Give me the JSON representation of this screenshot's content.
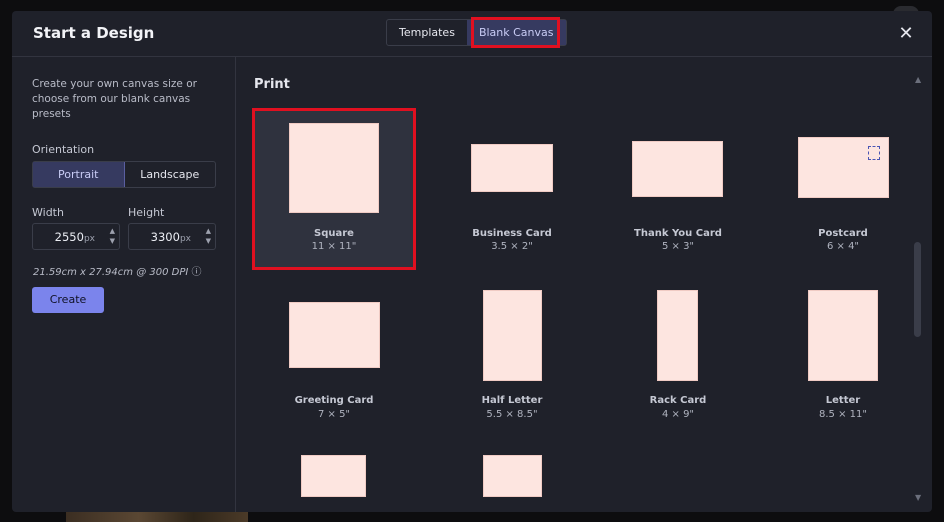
{
  "modal": {
    "title": "Start a Design",
    "tabs": [
      {
        "label": "Templates",
        "active": false
      },
      {
        "label": "Blank Canvas",
        "active": true
      }
    ],
    "close_icon": "close-icon"
  },
  "left_panel": {
    "description": "Create your own canvas size or choose from our blank canvas presets",
    "orientation_label": "Orientation",
    "orientation_options": [
      "Portrait",
      "Landscape"
    ],
    "orientation_selected": "Portrait",
    "width_label": "Width",
    "width_value": "2550",
    "height_label": "Height",
    "height_value": "3300",
    "unit": "px",
    "dimension_info": "21.59cm x 27.94cm @ 300 DPI",
    "info_icon": "info-icon",
    "create_label": "Create"
  },
  "print_section": {
    "heading": "Print",
    "presets": [
      {
        "name": "Square",
        "size": "11 × 11\"",
        "selected": true
      },
      {
        "name": "Business Card",
        "size": "3.5 × 2\""
      },
      {
        "name": "Thank You Card",
        "size": "5 × 3\""
      },
      {
        "name": "Postcard",
        "size": "6 × 4\""
      },
      {
        "name": "Greeting Card",
        "size": "7 × 5\""
      },
      {
        "name": "Half Letter",
        "size": "5.5 × 8.5\""
      },
      {
        "name": "Rack Card",
        "size": "4 × 9\""
      },
      {
        "name": "Letter",
        "size": "8.5 × 11\""
      },
      {
        "name": "",
        "size": ""
      },
      {
        "name": "",
        "size": ""
      }
    ]
  },
  "colors": {
    "accent": "#7b84ec",
    "active_tab_bg": "#363a60",
    "highlight": "#e01020",
    "preset_fill": "#fde5e0"
  }
}
